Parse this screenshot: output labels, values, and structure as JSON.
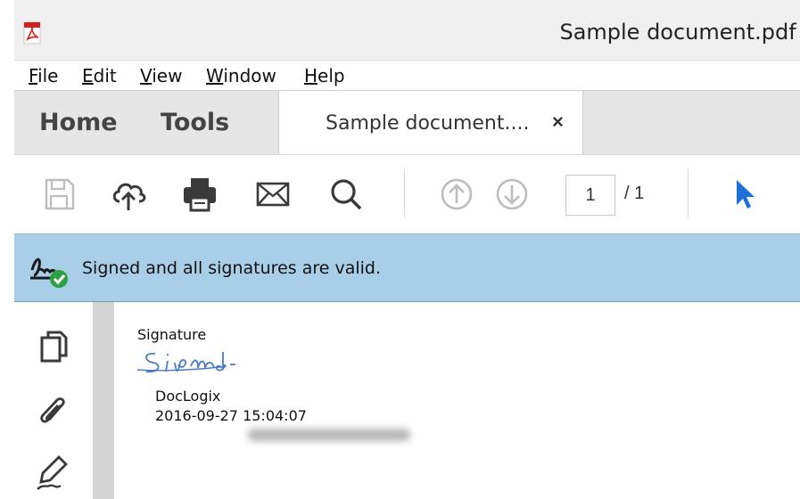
{
  "window": {
    "title": "Sample document.pdf -",
    "app_icon": "pdf-app-icon"
  },
  "menu": {
    "items": [
      {
        "label": "File",
        "mnemonic": "F",
        "rest": "ile"
      },
      {
        "label": "Edit",
        "mnemonic": "E",
        "rest": "dit"
      },
      {
        "label": "View",
        "mnemonic": "V",
        "rest": "iew"
      },
      {
        "label": "Window",
        "mnemonic": "W",
        "rest": "indow"
      },
      {
        "label": "Help",
        "mnemonic": "H",
        "rest": "elp"
      }
    ]
  },
  "tabs": {
    "home": "Home",
    "tools": "Tools",
    "document": "Sample document....",
    "close": "×"
  },
  "toolbar": {
    "icons": [
      "save-icon",
      "upload-cloud-icon",
      "print-icon",
      "email-icon",
      "search-icon",
      "page-up-icon",
      "page-down-icon",
      "select-cursor-icon"
    ],
    "page_current": "1",
    "page_total": "/ 1"
  },
  "signature_banner": {
    "message": "Signed and all signatures are valid.",
    "icon": "signature-valid-icon"
  },
  "left_rail": {
    "icons": [
      "pages-copy-icon",
      "attachment-clip-icon",
      "signature-pen-icon"
    ]
  },
  "page_content": {
    "heading": "Signature",
    "signer": "DocLogix",
    "timestamp": "2016-09-27 15:04:07"
  },
  "colors": {
    "banner_bg": "#a9cfe8",
    "cursor_blue": "#1e6fd6",
    "valid_green": "#2ea043",
    "pdf_red": "#d4201c"
  }
}
